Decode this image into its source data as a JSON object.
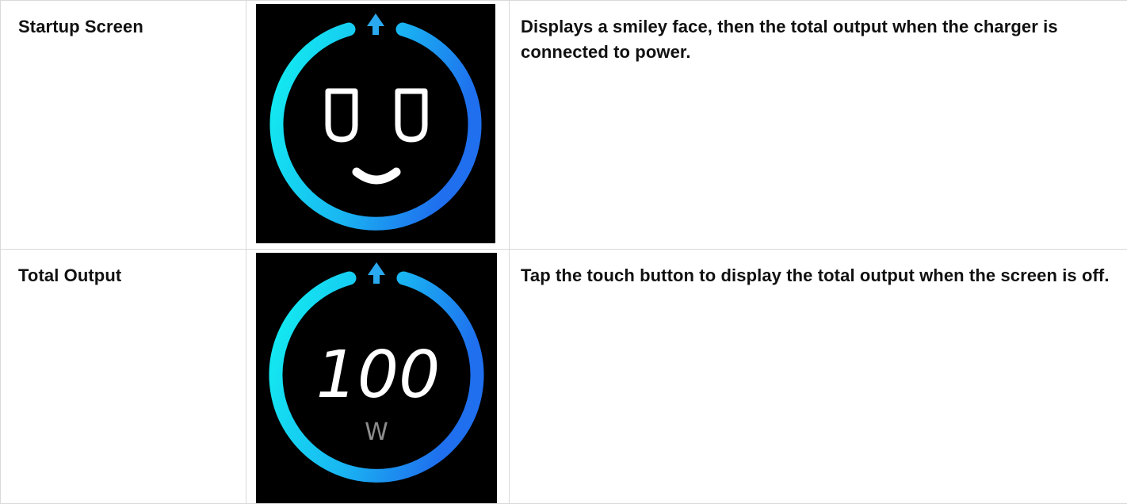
{
  "rows": [
    {
      "label": "Startup Screen",
      "description": "Displays a smiley face, then the total output when the charger is connected to power."
    },
    {
      "label": "Total Output",
      "description": "Tap the touch button to display the total output when the screen is off.",
      "display": {
        "value": "100",
        "unit": "W"
      }
    }
  ],
  "colors": {
    "ring_start": "#12e6f2",
    "ring_end": "#1f73ee",
    "arrow": "#2aa9f0",
    "face": "#ffffff",
    "border": "#d9d9d9"
  }
}
